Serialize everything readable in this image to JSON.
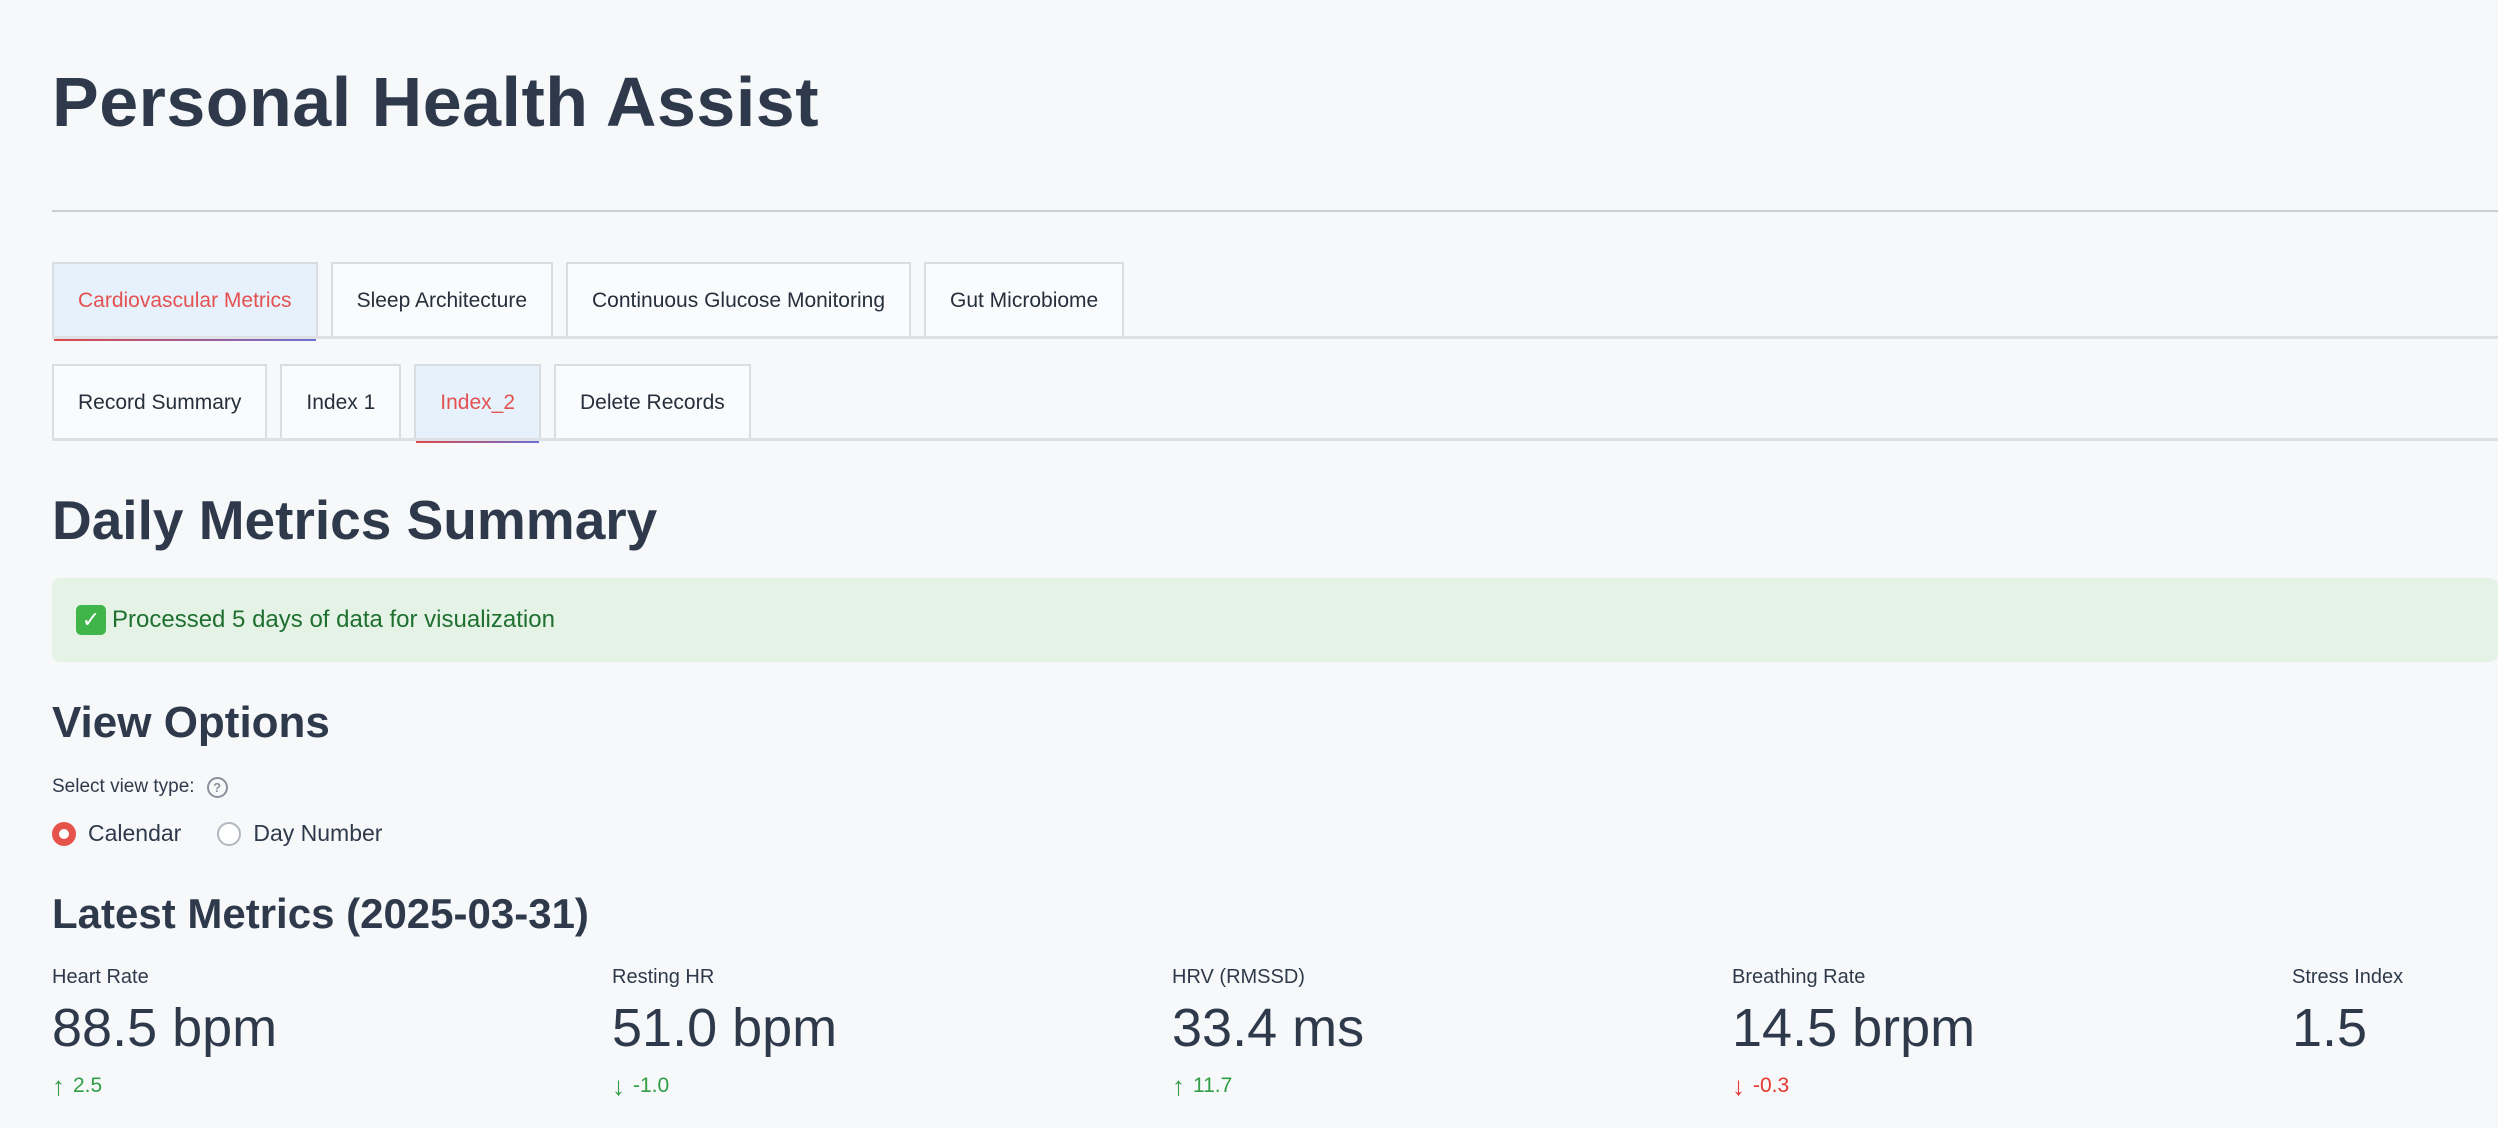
{
  "app": {
    "title": "Personal Health Assist"
  },
  "main_tabs": [
    {
      "label": "Cardiovascular Metrics",
      "active": true
    },
    {
      "label": "Sleep Architecture",
      "active": false
    },
    {
      "label": "Continuous Glucose Monitoring",
      "active": false
    },
    {
      "label": "Gut Microbiome",
      "active": false
    }
  ],
  "sub_tabs": [
    {
      "label": "Record Summary",
      "active": false
    },
    {
      "label": "Index 1",
      "active": false
    },
    {
      "label": "Index_2",
      "active": true
    },
    {
      "label": "Delete Records",
      "active": false
    }
  ],
  "summary": {
    "heading": "Daily Metrics Summary",
    "success_message": "Processed 5 days of data for visualization"
  },
  "view_options": {
    "heading": "View Options",
    "select_label": "Select view type:",
    "options": [
      {
        "label": "Calendar",
        "selected": true
      },
      {
        "label": "Day Number",
        "selected": false
      }
    ]
  },
  "latest": {
    "heading": "Latest Metrics (2025-03-31)",
    "metrics": [
      {
        "label": "Heart Rate",
        "value": "88.5 bpm",
        "delta": "2.5",
        "direction": "up",
        "delta_color": "#2f9e44"
      },
      {
        "label": "Resting HR",
        "value": "51.0 bpm",
        "delta": "-1.0",
        "direction": "down",
        "delta_color": "#2f9e44"
      },
      {
        "label": "HRV (RMSSD)",
        "value": "33.4 ms",
        "delta": "11.7",
        "direction": "up",
        "delta_color": "#2f9e44"
      },
      {
        "label": "Breathing Rate",
        "value": "14.5 brpm",
        "delta": "-0.3",
        "direction": "down",
        "delta_color": "#e5372f"
      },
      {
        "label": "Stress Index",
        "value": "1.5"
      }
    ]
  },
  "colors": {
    "accent": "#e5534b",
    "success_bg": "#e5f3e7",
    "success_text": "#1f7030",
    "heading": "#2e3a4b"
  }
}
